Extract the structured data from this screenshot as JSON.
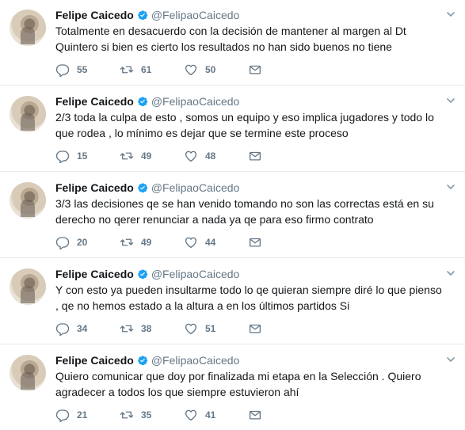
{
  "tweets": [
    {
      "name": "Felipe Caicedo",
      "handle": "@FelipaoCaicedo",
      "text": "Totalmente en desacuerdo con la decisión de mantener al margen al Dt Quintero si bien es cierto los resultados no han sido buenos no tiene",
      "replies": "55",
      "retweets": "61",
      "likes": "50"
    },
    {
      "name": "Felipe Caicedo",
      "handle": "@FelipaoCaicedo",
      "text": "2/3 toda la culpa de esto , somos un equipo y eso implica jugadores y todo lo que rodea , lo mínimo es dejar que se termine este proceso",
      "replies": "15",
      "retweets": "49",
      "likes": "48"
    },
    {
      "name": "Felipe Caicedo",
      "handle": "@FelipaoCaicedo",
      "text": "3/3 las decisiones qe se han venido tomando no son las correctas está en su derecho no qerer renunciar a nada ya qe para eso firmo contrato",
      "replies": "20",
      "retweets": "49",
      "likes": "44"
    },
    {
      "name": "Felipe Caicedo",
      "handle": "@FelipaoCaicedo",
      "text": "Y con esto ya pueden insultarme todo lo qe quieran siempre diré lo que pienso , qe no hemos estado a la altura a en los últimos partidos Si",
      "replies": "34",
      "retweets": "38",
      "likes": "51"
    },
    {
      "name": "Felipe Caicedo",
      "handle": "@FelipaoCaicedo",
      "text": "Quiero comunicar que doy por finalizada mi etapa en la Selección . Quiero agradecer a todos los que siempre estuvieron ahí",
      "replies": "21",
      "retweets": "35",
      "likes": "41"
    }
  ],
  "icons": {
    "verified": "verified-badge-icon",
    "reply": "reply-icon",
    "retweet": "retweet-icon",
    "like": "heart-icon",
    "dm": "envelope-icon",
    "caret": "chevron-down-icon"
  },
  "colors": {
    "verified": "#1da1f2",
    "icon": "#657786",
    "divider": "#e6ecf0"
  }
}
